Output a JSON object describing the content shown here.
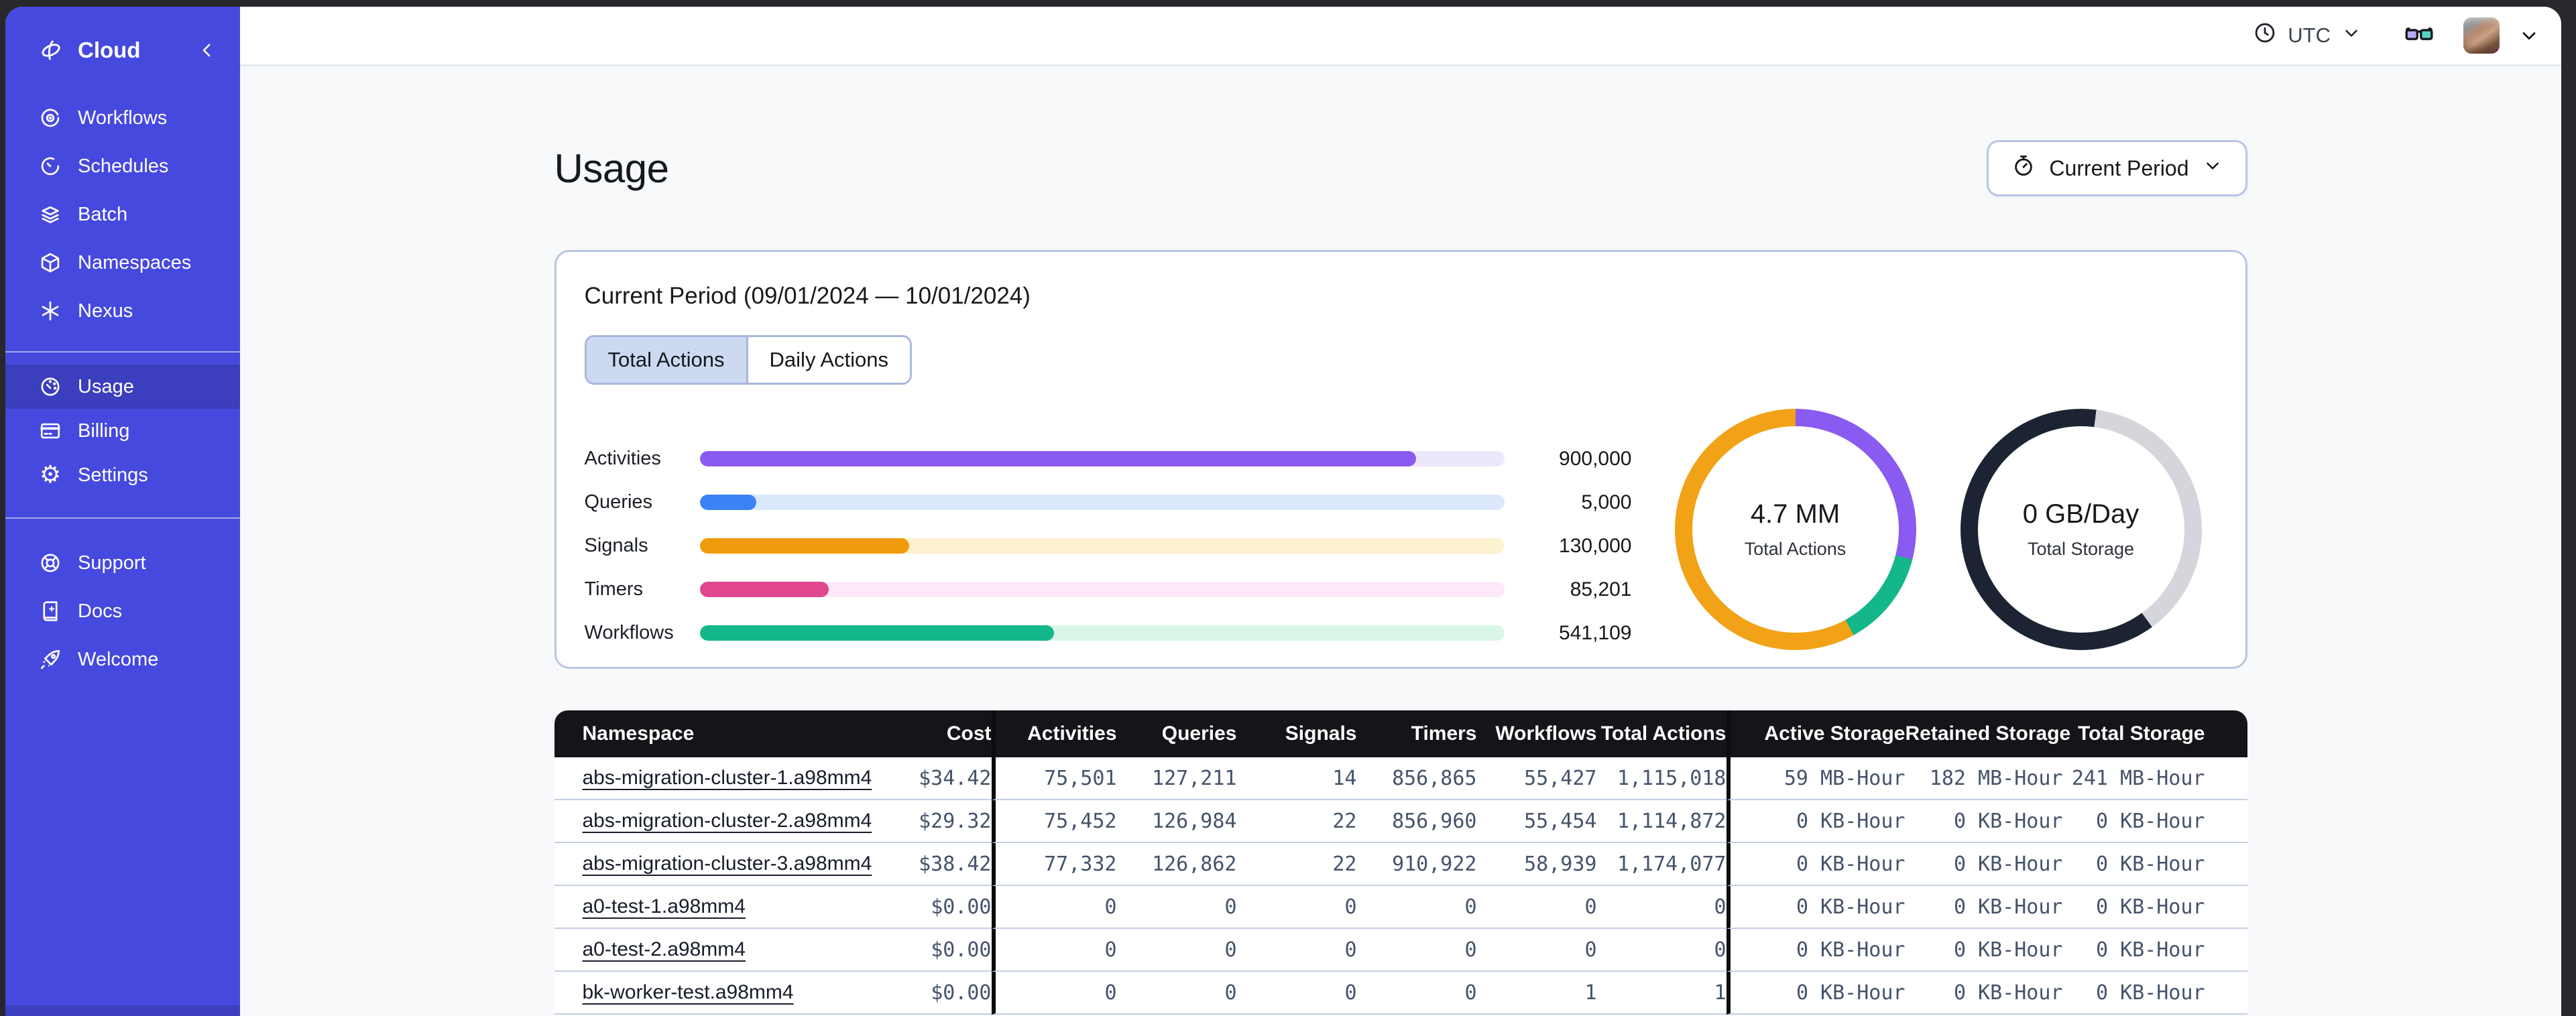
{
  "sidebar": {
    "logo": "Cloud",
    "colors": {
      "bg": "#4649DE",
      "active_bg": "#3B3EBD"
    },
    "groups": [
      {
        "items": [
          {
            "label": "Workflows"
          },
          {
            "label": "Schedules"
          },
          {
            "label": "Batch"
          },
          {
            "label": "Namespaces"
          },
          {
            "label": "Nexus"
          }
        ]
      },
      {
        "items": [
          {
            "label": "Usage",
            "active": true
          },
          {
            "label": "Billing"
          },
          {
            "label": "Settings"
          }
        ]
      },
      {
        "items": [
          {
            "label": "Support"
          },
          {
            "label": "Docs"
          },
          {
            "label": "Welcome"
          }
        ]
      }
    ]
  },
  "topbar": {
    "timezone": "UTC"
  },
  "page": {
    "title": "Usage",
    "period_selector": {
      "label": "Current Period"
    }
  },
  "usage_card": {
    "title": "Current Period (09/01/2024 — 10/01/2024)",
    "tabs": [
      {
        "label": "Total Actions",
        "active": true
      },
      {
        "label": "Daily Actions",
        "active": false
      }
    ]
  },
  "chart_data": [
    {
      "type": "bar",
      "title": "Actions by type (current period)",
      "categories": [
        "Activities",
        "Queries",
        "Signals",
        "Timers",
        "Workflows"
      ],
      "values": [
        900000,
        5000,
        130000,
        85201,
        541109
      ],
      "value_labels": [
        "900,000",
        "5,000",
        "130,000",
        "85,201",
        "541,109"
      ],
      "fill_pct": [
        89,
        7,
        26,
        16,
        44
      ],
      "bar_colors": [
        "#8a5bf0",
        "#3b82f6",
        "#f09b0b",
        "#e0478f",
        "#14b789"
      ],
      "track_colors": [
        "#ede7fd",
        "#dbe7fb",
        "#fdf2cf",
        "#fce8f8",
        "#d9f6e9"
      ]
    },
    {
      "type": "pie",
      "label": "4.7 MM",
      "sublabel": "Total Actions",
      "segments": [
        {
          "color": "#8a5bf0",
          "pct": 29
        },
        {
          "color": "#14b789",
          "pct": 13
        },
        {
          "color": "#f2a216",
          "pct": 58
        }
      ]
    },
    {
      "type": "pie",
      "label": "0 GB/Day",
      "sublabel": "Total Storage",
      "segments": [
        {
          "color": "#1c2433",
          "pct": 2
        },
        {
          "color": "#d4d6db",
          "pct": 38
        },
        {
          "color": "#1c2433",
          "pct": 60
        }
      ]
    }
  ],
  "table": {
    "columns": [
      "Namespace",
      "Cost",
      "Activities",
      "Queries",
      "Signals",
      "Timers",
      "Workflows",
      "Total Actions",
      "Active Storage",
      "Retained Storage",
      "Total Storage"
    ],
    "rows": [
      [
        "abs-migration-cluster-1.a98mm4",
        "$34.42",
        "75,501",
        "127,211",
        "14",
        "856,865",
        "55,427",
        "1,115,018",
        "59 MB-Hour",
        "182 MB-Hour",
        "241 MB-Hour"
      ],
      [
        "abs-migration-cluster-2.a98mm4",
        "$29.32",
        "75,452",
        "126,984",
        "22",
        "856,960",
        "55,454",
        "1,114,872",
        "0 KB-Hour",
        "0 KB-Hour",
        "0 KB-Hour"
      ],
      [
        "abs-migration-cluster-3.a98mm4",
        "$38.42",
        "77,332",
        "126,862",
        "22",
        "910,922",
        "58,939",
        "1,174,077",
        "0 KB-Hour",
        "0 KB-Hour",
        "0 KB-Hour"
      ],
      [
        "a0-test-1.a98mm4",
        "$0.00",
        "0",
        "0",
        "0",
        "0",
        "0",
        "0",
        "0 KB-Hour",
        "0 KB-Hour",
        "0 KB-Hour"
      ],
      [
        "a0-test-2.a98mm4",
        "$0.00",
        "0",
        "0",
        "0",
        "0",
        "0",
        "0",
        "0 KB-Hour",
        "0 KB-Hour",
        "0 KB-Hour"
      ],
      [
        "bk-worker-test.a98mm4",
        "$0.00",
        "0",
        "0",
        "0",
        "0",
        "1",
        "1",
        "0 KB-Hour",
        "0 KB-Hour",
        "0 KB-Hour"
      ]
    ]
  }
}
